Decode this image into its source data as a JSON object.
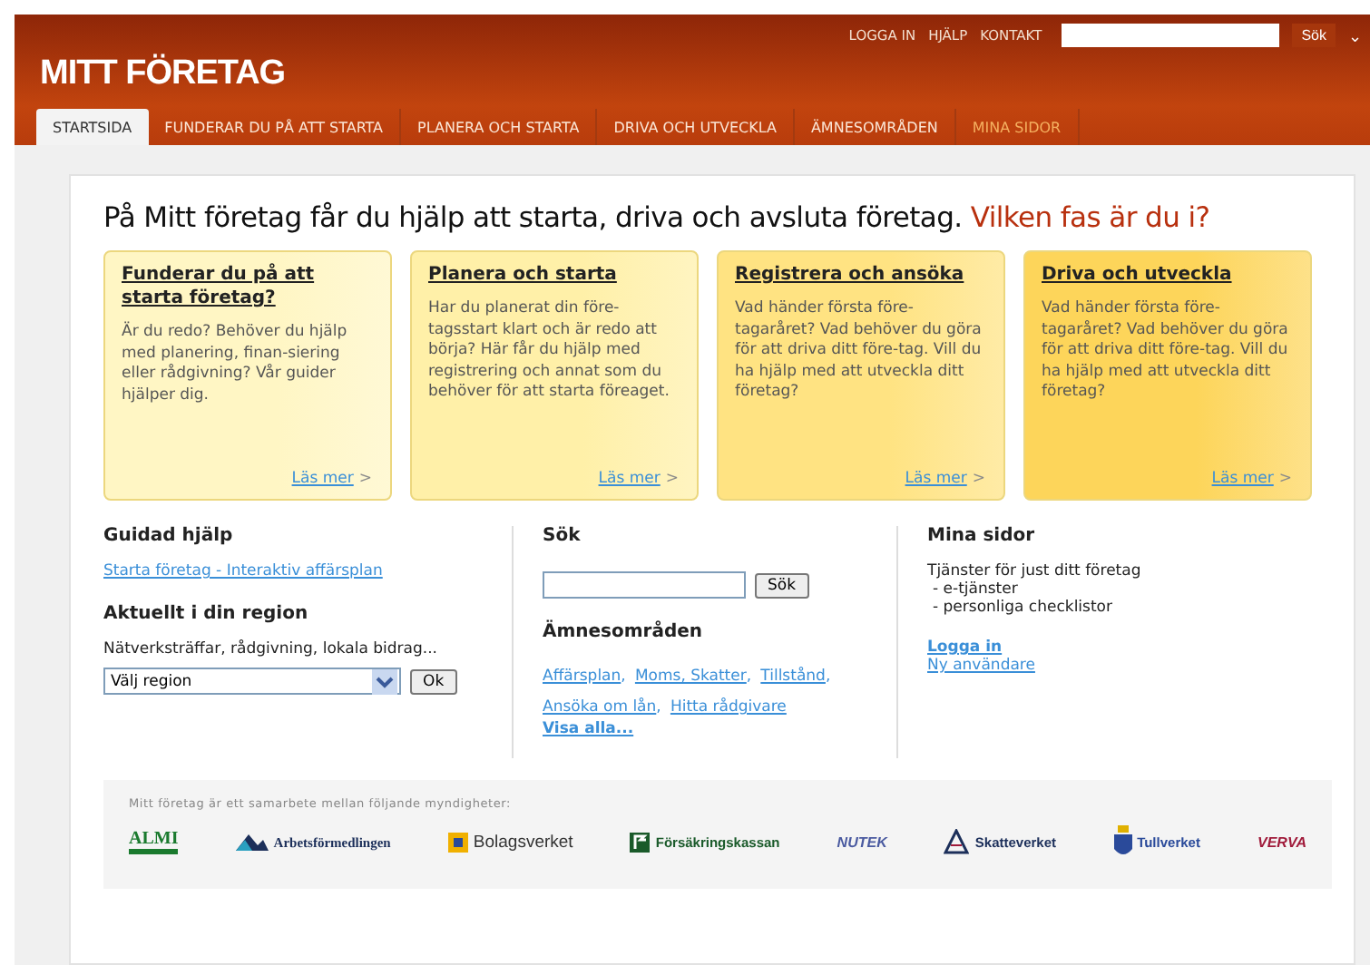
{
  "header": {
    "logo": "MITT FÖRETAG",
    "top_links": [
      "LOGGA IN",
      "HJÄLP",
      "KONTAKT"
    ],
    "search_button": "Sök",
    "menu_caret": "⌄"
  },
  "tabs": [
    {
      "label": "STARTSIDA",
      "selected": true,
      "highlight": false
    },
    {
      "label": "FUNDERAR DU PÅ ATT STARTA",
      "selected": false,
      "highlight": false
    },
    {
      "label": "PLANERA OCH STARTA",
      "selected": false,
      "highlight": false
    },
    {
      "label": "DRIVA OCH UTVECKLA",
      "selected": false,
      "highlight": false
    },
    {
      "label": "ÄMNESOMRÅDEN",
      "selected": false,
      "highlight": false
    },
    {
      "label": "MINA SIDOR",
      "selected": false,
      "highlight": true
    }
  ],
  "headline": {
    "text": "På Mitt företag får du hjälp att starta, driva och avsluta företag.",
    "accent": "Vilken fas är du i?"
  },
  "cards": [
    {
      "title": "Funderar du på att starta företag?",
      "body": "Är du redo? Behöver du hjälp med planering, finan-siering eller rådgivning? Vår guider hjälper dig.",
      "link": "Läs mer",
      "arrow": ">",
      "color": "#fff6c4"
    },
    {
      "title": "Planera och starta",
      "body": "Har du planerat din före-tagsstart klart och är redo att börja? Här får du hjälp med registrering och annat som du behöver för att starta föreaget.",
      "link": "Läs mer",
      "arrow": ">",
      "color": "#fff0a8"
    },
    {
      "title": "Registrera och ansöka",
      "body": "Vad händer första före-tagaråret? Vad behöver du göra för att driva ditt före-tag. Vill du ha hjälp med att utveckla ditt företag?",
      "link": "Läs mer",
      "arrow": ">",
      "color": "#ffe382"
    },
    {
      "title": "Driva och utveckla",
      "body": "Vad händer första före-tagaråret? Vad behöver du göra för att driva ditt före-tag. Vill du ha hjälp med att utveckla ditt företag?",
      "link": "Läs mer",
      "arrow": ">",
      "color": "#fdd55a"
    }
  ],
  "guided_help": {
    "title": "Guidad hjälp",
    "link": "Starta företag - Interaktiv affärsplan"
  },
  "region": {
    "title": "Aktuellt i din region",
    "text": "Nätverksträffar, rådgivning, lokala bidrag...",
    "select": "Välj region",
    "button": "Ok"
  },
  "search": {
    "title": "Sök",
    "button": "Sök"
  },
  "topics": {
    "title": "Ämnesområden",
    "links": [
      "Affärsplan",
      "Moms, Skatter",
      "Tillstånd",
      "Ansöka om lån",
      "Hitta rådgivare"
    ],
    "separator": ",",
    "more": "Visa alla..."
  },
  "my_pages": {
    "title": "Mina sidor",
    "intro": "Tjänster för just ditt företag",
    "items": [
      "- e-tjänster",
      "- personliga checklistor"
    ],
    "login": "Logga in",
    "new_user": "Ny användare"
  },
  "partners": {
    "intro": "Mitt företag är ett samarbete mellan följande myndigheter:",
    "logos": [
      {
        "name": "ALMI",
        "kind": "almi",
        "color": "#1a7a2e"
      },
      {
        "name": "Arbetsförmedlingen",
        "kind": "mountain",
        "color": "#1c2f5a"
      },
      {
        "name": "Bolagsverket",
        "kind": "square",
        "color": "#333333"
      },
      {
        "name": "Försäkringskassan",
        "kind": "flag",
        "color": "#1a5a2a"
      },
      {
        "name": "NUTEK",
        "kind": "plain",
        "color": "#4a5aa0"
      },
      {
        "name": "Skatteverket",
        "kind": "pyramid",
        "color": "#1c2f5a"
      },
      {
        "name": "Tullverket",
        "kind": "crest",
        "color": "#2a4a9a"
      },
      {
        "name": "VERVA",
        "kind": "plain",
        "color": "#a01a3a"
      }
    ]
  }
}
